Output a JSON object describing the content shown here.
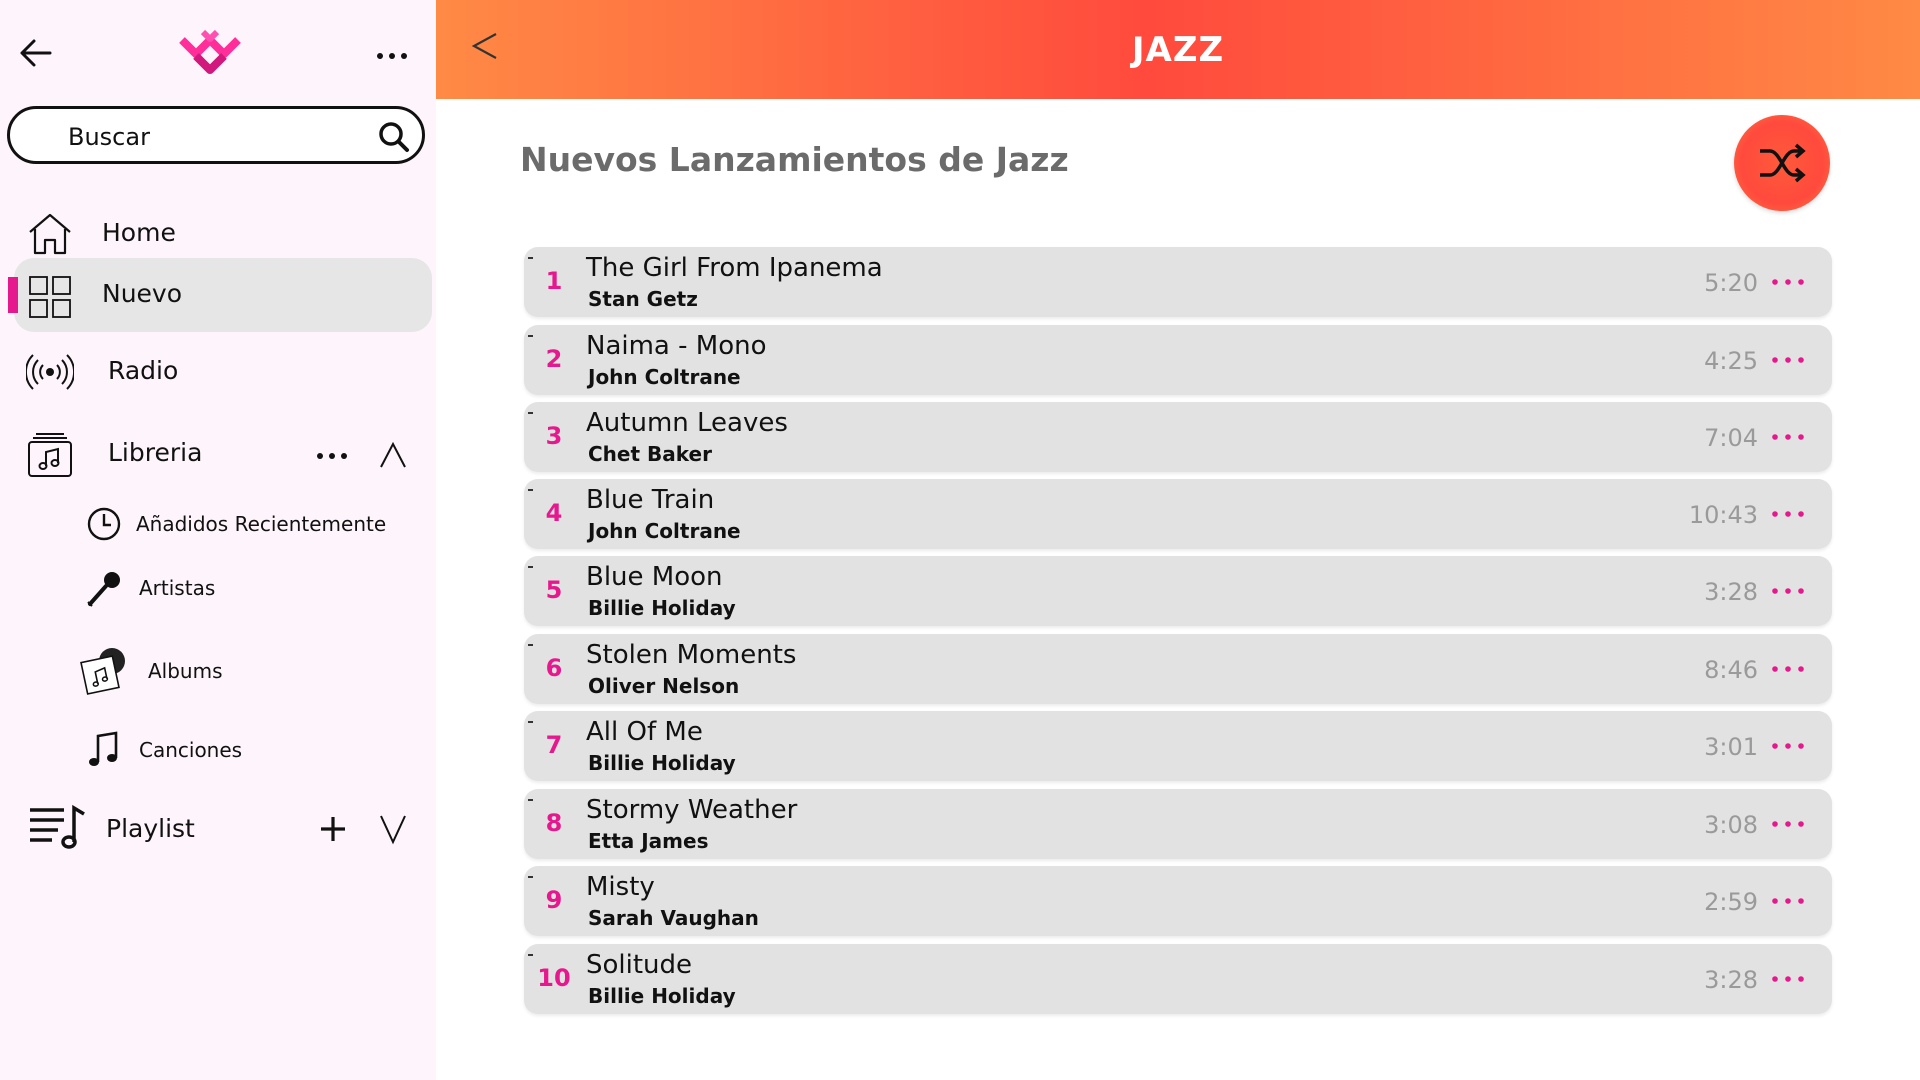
{
  "sidebar": {
    "search": {
      "placeholder": "Buscar"
    },
    "nav": [
      {
        "label": "Home",
        "icon": "home-icon"
      },
      {
        "label": "Nuevo",
        "icon": "grid-icon",
        "active": true
      },
      {
        "label": "Radio",
        "icon": "radio-broadcast-icon"
      },
      {
        "label": "Libreria",
        "icon": "library-music-icon"
      }
    ],
    "library_sub": [
      {
        "label": "Añadidos Recientemente",
        "icon": "clock-icon"
      },
      {
        "label": "Artistas",
        "icon": "microphone-icon"
      },
      {
        "label": "Albums",
        "icon": "album-icon"
      },
      {
        "label": "Canciones",
        "icon": "music-note-icon"
      }
    ],
    "playlist": {
      "label": "Playlist",
      "icon": "playlist-icon"
    }
  },
  "header": {
    "title": "JAZZ"
  },
  "main": {
    "section_title": "Nuevos Lanzamientos de Jazz",
    "tracks": [
      {
        "num": "1",
        "title": "The Girl From Ipanema",
        "artist": "Stan Getz",
        "duration": "5:20"
      },
      {
        "num": "2",
        "title": "Naima - Mono",
        "artist": "John Coltrane",
        "duration": "4:25"
      },
      {
        "num": "3",
        "title": "Autumn Leaves",
        "artist": "Chet Baker",
        "duration": "7:04"
      },
      {
        "num": "4",
        "title": "Blue Train",
        "artist": "John Coltrane",
        "duration": "10:43"
      },
      {
        "num": "5",
        "title": "Blue Moon",
        "artist": "Billie Holiday",
        "duration": "3:28"
      },
      {
        "num": "6",
        "title": "Stolen Moments",
        "artist": "Oliver Nelson",
        "duration": "8:46"
      },
      {
        "num": "7",
        "title": "All Of  Me",
        "artist": "Billie Holiday",
        "duration": "3:01"
      },
      {
        "num": "8",
        "title": "Stormy Weather",
        "artist": "Etta James",
        "duration": "3:08"
      },
      {
        "num": "9",
        "title": "Misty",
        "artist": "Sarah Vaughan",
        "duration": "2:59"
      },
      {
        "num": "10",
        "title": "Solitude",
        "artist": "Billie Holiday",
        "duration": "3:28"
      }
    ]
  },
  "colors": {
    "accent": "#e6188d",
    "header_start": "#ff8a45",
    "header_mid": "#ff4a3d",
    "sidebar_bg": "#fdf5fb",
    "row_bg": "#e2e2e2"
  }
}
